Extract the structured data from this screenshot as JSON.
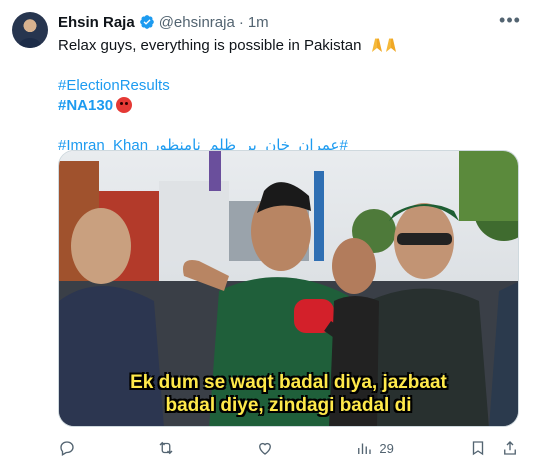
{
  "tweet": {
    "author_name": "Ehsin Raja",
    "handle": "@ehsinraja",
    "separator": "·",
    "time": "1m",
    "more_label": "•••",
    "text_line": "Relax guys, everything is possible in Pakistan",
    "hashtag_1": "#ElectionResults",
    "hashtag_2": "#NA130",
    "hashtag_3": "#Imran_Khan",
    "hashtag_urdu": "#عمران_خان_پر_ظلم_نامنظور",
    "video_caption_line1": "Ek dum se waqt badal diya, jazbaat",
    "video_caption_line2": "badal diye, zindagi badal di"
  },
  "actions": {
    "reply_count": "",
    "retweet_count": "",
    "like_count": "",
    "views_count": "29"
  },
  "icons": [
    "verified-icon",
    "more-icon",
    "pray-emoji-icon",
    "angry-face-icon",
    "reply-icon",
    "retweet-icon",
    "like-icon",
    "views-icon",
    "bookmark-icon",
    "share-icon"
  ],
  "colors": {
    "link": "#1d9bf0",
    "muted": "#536471",
    "text": "#0f1419",
    "caption": "#ffe94a"
  }
}
